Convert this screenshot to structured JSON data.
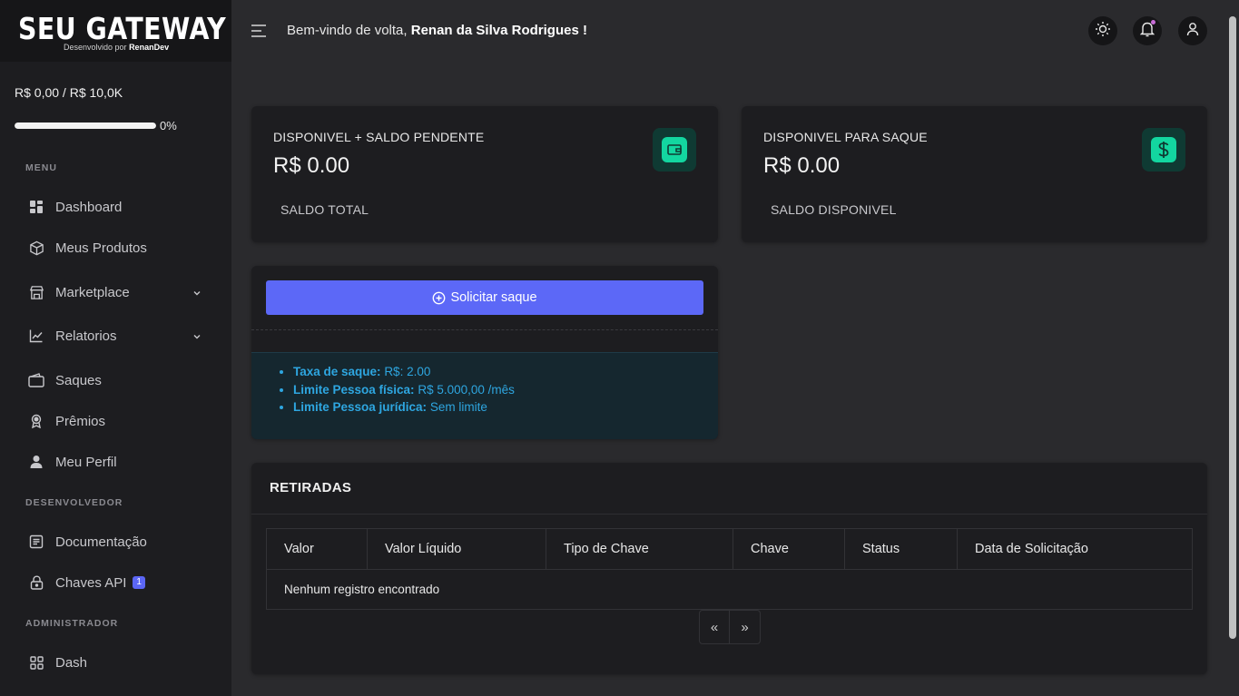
{
  "brand": {
    "name": "SEU GATEWAY",
    "subtitle_prefix": "Desenvolvido por",
    "subtitle_author": "RenanDev"
  },
  "sidebar": {
    "balance": "R$ 0,00 / R$ 10,0K",
    "progress_percent": 0,
    "progress_label": "0%",
    "sections": {
      "menu": "MENU",
      "dev": "DESENVOLVEDOR",
      "admin": "ADMINISTRADOR"
    },
    "items": [
      {
        "label": "Dashboard",
        "icon": "dashboard-icon"
      },
      {
        "label": "Meus Produtos",
        "icon": "box-icon"
      },
      {
        "label": "Marketplace",
        "icon": "store-icon",
        "expandable": true
      },
      {
        "label": "Relatorios",
        "icon": "chart-line-icon",
        "expandable": true
      },
      {
        "label": "Saques",
        "icon": "wallet-icon"
      },
      {
        "label": "Prêmios",
        "icon": "award-icon"
      },
      {
        "label": "Meu Perfil",
        "icon": "user-icon"
      },
      {
        "label": "Documentação",
        "icon": "document-icon"
      },
      {
        "label": "Chaves API",
        "icon": "lock-icon",
        "badge": "1"
      },
      {
        "label": "Dash",
        "icon": "grid-icon"
      }
    ]
  },
  "header": {
    "welcome_prefix": "Bem-vindo de volta,",
    "user_name": "Renan da Silva Rodrigues !",
    "actions": [
      "sun-icon",
      "bell-icon",
      "user-icon"
    ]
  },
  "cards": {
    "total": {
      "title": "DISPONIVEL + SALDO PENDENTE",
      "value": "R$ 0.00",
      "footer": "SALDO TOTAL",
      "icon": "wallet-icon"
    },
    "available": {
      "title": "DISPONIVEL PARA SAQUE",
      "value": "R$ 0.00",
      "footer": "SALDO DISPONIVEL",
      "icon": "dollar-icon"
    }
  },
  "withdraw": {
    "button_label": "Solicitar saque",
    "info": [
      {
        "label": "Taxa de saque:",
        "value": "R$: 2.00"
      },
      {
        "label": "Limite Pessoa física:",
        "value": "R$ 5.000,00 /mês"
      },
      {
        "label": "Limite Pessoa jurídica:",
        "value": "Sem limite"
      }
    ]
  },
  "withdrawals": {
    "title": "RETIRADAS",
    "columns": [
      "Valor",
      "Valor Líquido",
      "Tipo de Chave",
      "Chave",
      "Status",
      "Data de Solicitação"
    ],
    "empty_message": "Nenhum registro encontrado",
    "pager": {
      "prev": "«",
      "next": "»"
    }
  },
  "colors": {
    "accent": "#5c68f7",
    "success": "#13d6a0",
    "info": "#2ea6e0",
    "background": "#2a2a2d",
    "panel": "#1d1d20"
  }
}
